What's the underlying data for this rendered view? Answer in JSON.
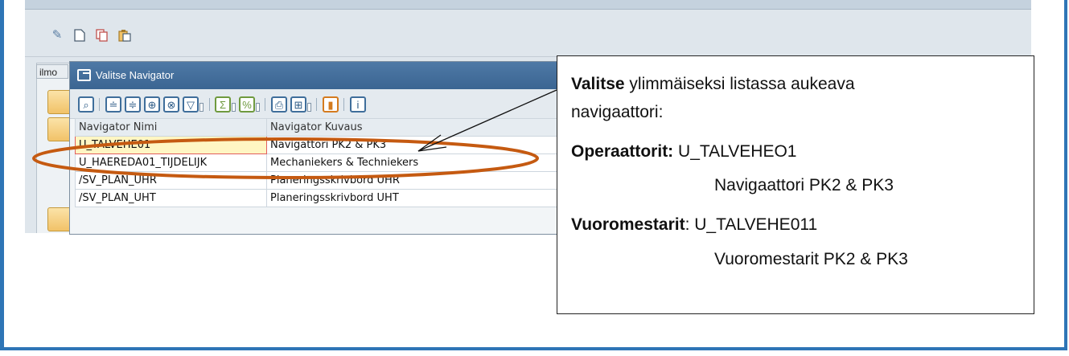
{
  "sap": {
    "tab_label": "ilmo",
    "toolbar_icons": [
      "pencil-icon",
      "new-document-icon",
      "copy-icon",
      "clipboard-icon"
    ]
  },
  "dialog": {
    "title": "Valitse Navigator",
    "columns": [
      "Navigator Nimi",
      "Navigator Kuvaus"
    ],
    "rows": [
      {
        "name": "U_TALVEHE01",
        "desc": "Navigattori PK2 & PK3"
      },
      {
        "name": "U_HAEREDA01_TIJDELIJK",
        "desc": "Mechaniekers & Techniekers"
      },
      {
        "name": "/SV_PLAN_UHR",
        "desc": "Planeringsskrivbord UHR"
      },
      {
        "name": "/SV_PLAN_UHT",
        "desc": "Planeringsskrivbord UHT"
      }
    ],
    "toolbar_icons": [
      "details-icon",
      "sort-ascending-icon",
      "sort-descending-icon",
      "find-icon",
      "find-next-icon",
      "filter-icon",
      "sum-icon",
      "subtotal-icon",
      "print-icon",
      "layout-icon",
      "export-icon",
      "info-icon"
    ]
  },
  "callout": {
    "line1_bold": "Valitse",
    "line1_rest": " ylimmäiseksi listassa aukeava",
    "line2": "navigaattori:",
    "op_label": "Operaattorit:",
    "op_value": " U_TALVEHEO1",
    "op_desc": "Navigaattori PK2 & PK3",
    "vm_label": "Vuoromestarit",
    "vm_value": ": U_TALVEHE011",
    "vm_desc": "Vuoromestarit PK2 & PK3"
  },
  "colors": {
    "frame": "#2e75b6",
    "highlight_ellipse": "#c55a11",
    "dialog_title_bg": "#3b6592"
  }
}
